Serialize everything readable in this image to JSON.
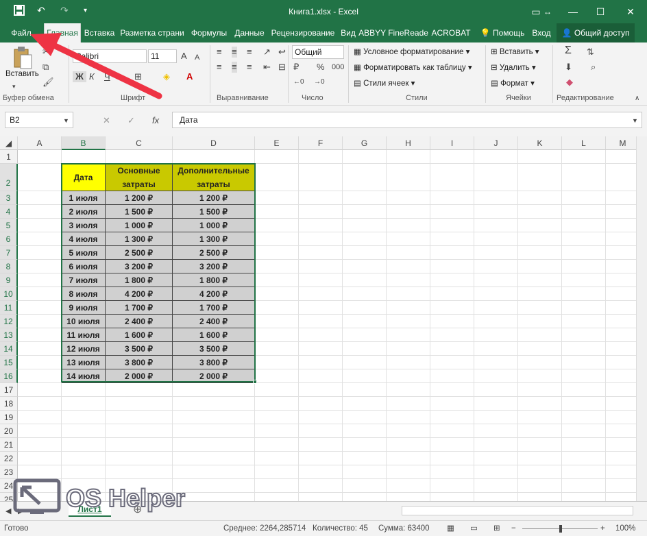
{
  "window": {
    "title": "Книга1.xlsx - Excel"
  },
  "tabs": [
    "Файл",
    "Главная",
    "Вставка",
    "Разметка страни",
    "Формулы",
    "Данные",
    "Рецензирование",
    "Вид",
    "ABBYY FineReade",
    "ACROBAT"
  ],
  "tell_me": "Помощь",
  "signin": "Вход",
  "share": "Общий доступ",
  "ribbon": {
    "paste": "Вставить",
    "font_name": "Calibri",
    "font_size": "11",
    "bold": "Ж",
    "italic": "К",
    "underline": "Ч",
    "number_format": "Общий",
    "cond_format": "Условное форматирование",
    "format_table": "Форматировать как таблицу",
    "cell_styles": "Стили ячеек",
    "insert": "Вставить",
    "delete": "Удалить",
    "format": "Формат",
    "groups": [
      "Буфер обмена",
      "Шрифт",
      "Выравнивание",
      "Число",
      "Стили",
      "Ячейки",
      "Редактирование"
    ]
  },
  "formula": {
    "namebox": "B2",
    "content": "Дата"
  },
  "columns": [
    "A",
    "B",
    "C",
    "D",
    "E",
    "F",
    "G",
    "H",
    "I",
    "J",
    "K",
    "L",
    "M"
  ],
  "rows": [
    "1",
    "2",
    "3",
    "4",
    "5",
    "6",
    "7",
    "8",
    "9",
    "10",
    "11",
    "12",
    "13",
    "14",
    "15",
    "16",
    "17",
    "18",
    "19",
    "20",
    "21",
    "22",
    "23",
    "24",
    "25"
  ],
  "table": {
    "headers": [
      "Дата",
      "Основные затраты",
      "Дополнительные затраты"
    ],
    "rows": [
      [
        "1 июля",
        "1 200 ₽",
        "1 200 ₽"
      ],
      [
        "2 июля",
        "1 500 ₽",
        "1 500 ₽"
      ],
      [
        "3 июля",
        "1 000 ₽",
        "1 000 ₽"
      ],
      [
        "4 июля",
        "1 300 ₽",
        "1 300 ₽"
      ],
      [
        "5 июля",
        "2 500 ₽",
        "2 500 ₽"
      ],
      [
        "6 июля",
        "3 200 ₽",
        "3 200 ₽"
      ],
      [
        "7 июля",
        "1 800 ₽",
        "1 800 ₽"
      ],
      [
        "8 июля",
        "4 200 ₽",
        "4 200 ₽"
      ],
      [
        "9 июля",
        "1 700 ₽",
        "1 700 ₽"
      ],
      [
        "10 июля",
        "2 400 ₽",
        "2 400 ₽"
      ],
      [
        "11 июля",
        "1 600 ₽",
        "1 600 ₽"
      ],
      [
        "12 июля",
        "3 500 ₽",
        "3 500 ₽"
      ],
      [
        "13 июля",
        "3 800 ₽",
        "3 800 ₽"
      ],
      [
        "14 июля",
        "2 000 ₽",
        "2 000 ₽"
      ]
    ]
  },
  "sheet": {
    "tab": "Лист1"
  },
  "status": {
    "ready": "Готово",
    "average": "Среднее: 2264,285714",
    "count": "Количество: 45",
    "sum": "Сумма: 63400",
    "zoom": "100%"
  },
  "watermark": {
    "text": "OS Helper"
  },
  "colors": {
    "excel_green": "#217346",
    "highlight_yellow": "#ffff00",
    "olive_header": "#c9c900",
    "annotation_arrow": "#ee3344"
  }
}
